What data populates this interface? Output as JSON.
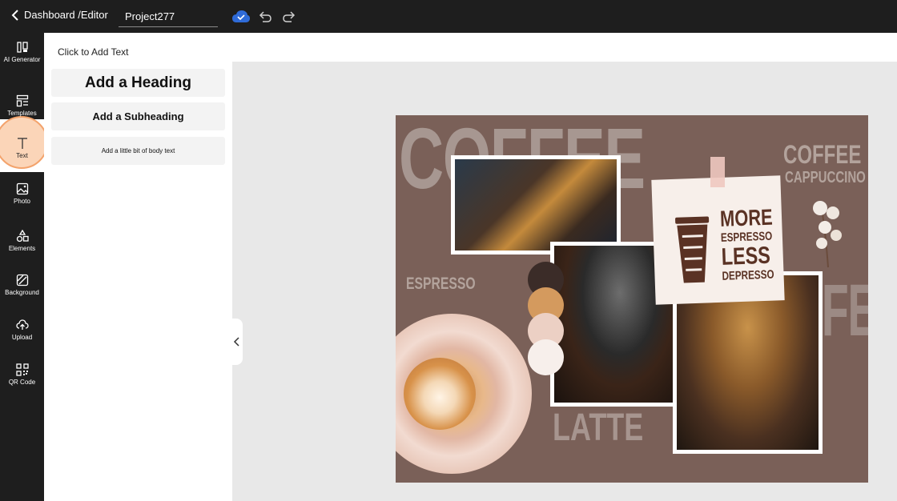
{
  "topbar": {
    "back_label": "Dashboard /Editor",
    "project_name": "Project277"
  },
  "rail": {
    "items": [
      {
        "label": "AI Generator",
        "icon": "ai-generator-icon"
      },
      {
        "label": "Templates",
        "icon": "templates-icon"
      },
      {
        "label": "Text",
        "icon": "text-icon",
        "active": true
      },
      {
        "label": "Photo",
        "icon": "photo-icon"
      },
      {
        "label": "Elements",
        "icon": "elements-icon"
      },
      {
        "label": "Background",
        "icon": "background-icon"
      },
      {
        "label": "Upload",
        "icon": "upload-icon"
      },
      {
        "label": "QR Code",
        "icon": "qr-code-icon"
      }
    ]
  },
  "panel": {
    "title": "Click to Add Text",
    "heading_btn": "Add a Heading",
    "subheading_btn": "Add a Subheading",
    "body_btn": "Add a little bit of body text"
  },
  "design": {
    "big_coffee": "COFFEE",
    "big_fee": "FEE",
    "coffee_small": "COFFEE",
    "cappuccino": "CAPPUCCINO",
    "espresso": "ESPRESSO",
    "latte": "LATTE",
    "note": {
      "line1": "MORE",
      "line2": "ESPRESSO",
      "line3": "LESS",
      "line4": "DEPRESSO"
    },
    "swatches": [
      "#3b2c28",
      "#d49a5e",
      "#ecd0c4",
      "#f7efeb"
    ]
  },
  "colors": {
    "topbar_bg": "#1e1e1e",
    "accent_active": "#f3a36c",
    "cloud_blue": "#2f6bd8",
    "design_bg": "#7a6058"
  }
}
